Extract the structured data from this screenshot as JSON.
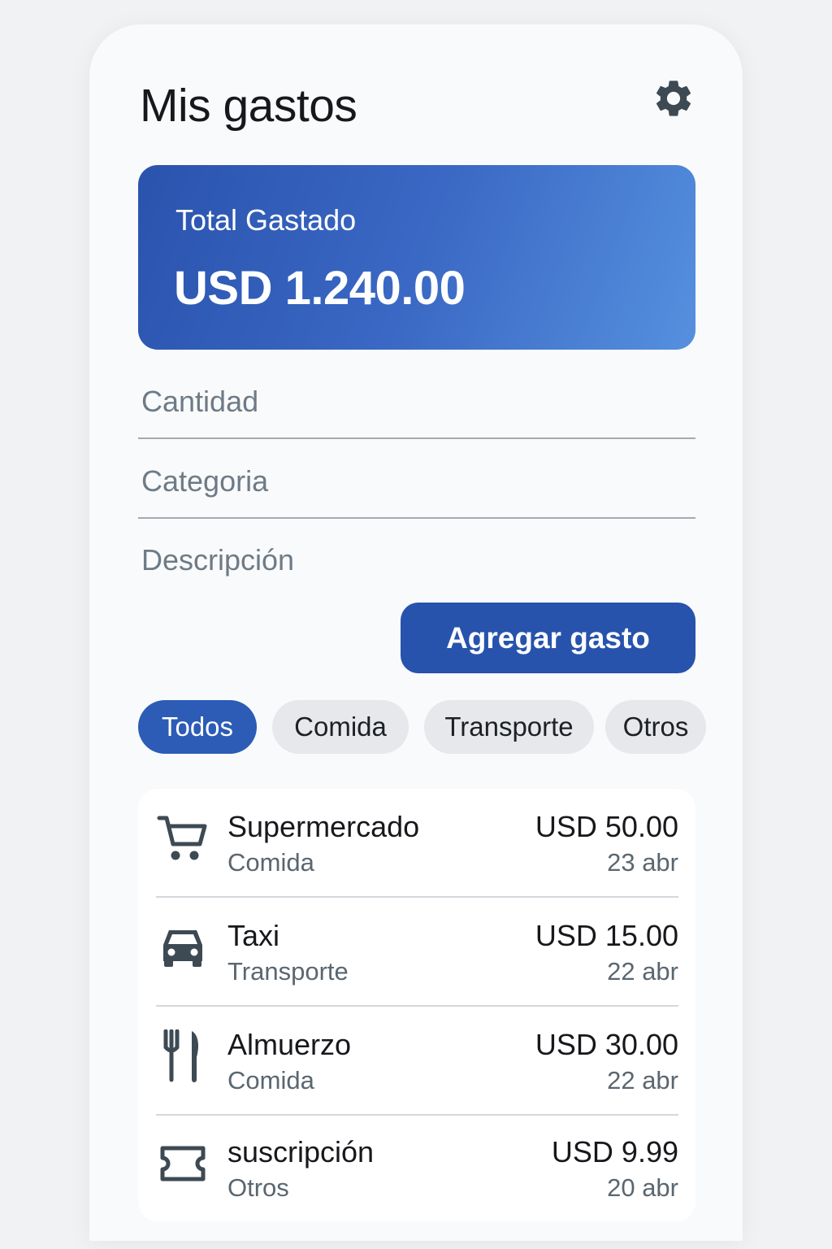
{
  "header": {
    "title": "Mis gastos",
    "settings_icon": "gear-icon"
  },
  "summary": {
    "label": "Total Gastado",
    "amount": "USD 1.240.00"
  },
  "form": {
    "amount_placeholder": "Cantidad",
    "category_placeholder": "Categoria",
    "description_placeholder": "Descripción",
    "submit_label": "Agregar gasto"
  },
  "filters": [
    {
      "label": "Todos",
      "selected": true
    },
    {
      "label": "Comida",
      "selected": false
    },
    {
      "label": "Transporte",
      "selected": false
    },
    {
      "label": "Otros",
      "selected": false
    }
  ],
  "expenses": [
    {
      "icon": "shopping-cart-icon",
      "name": "Supermercado",
      "category": "Comida",
      "amount": "USD 50.00",
      "date": "23 abr"
    },
    {
      "icon": "car-icon",
      "name": "Taxi",
      "category": "Transporte",
      "amount": "USD 15.00",
      "date": "22 abr"
    },
    {
      "icon": "fork-knife-icon",
      "name": "Almuerzo",
      "category": "Comida",
      "amount": "USD 30.00",
      "date": "22 abr"
    },
    {
      "icon": "ticket-icon",
      "name": "suscripción",
      "category": "Otros",
      "amount": "USD 9.99",
      "date": "20 abr"
    }
  ],
  "colors": {
    "accent": "#2753ad",
    "card_gradient_start": "#2a53ad",
    "card_gradient_end": "#5590de",
    "chip_inactive": "#e7e8eb",
    "icon": "#3d4a53"
  }
}
